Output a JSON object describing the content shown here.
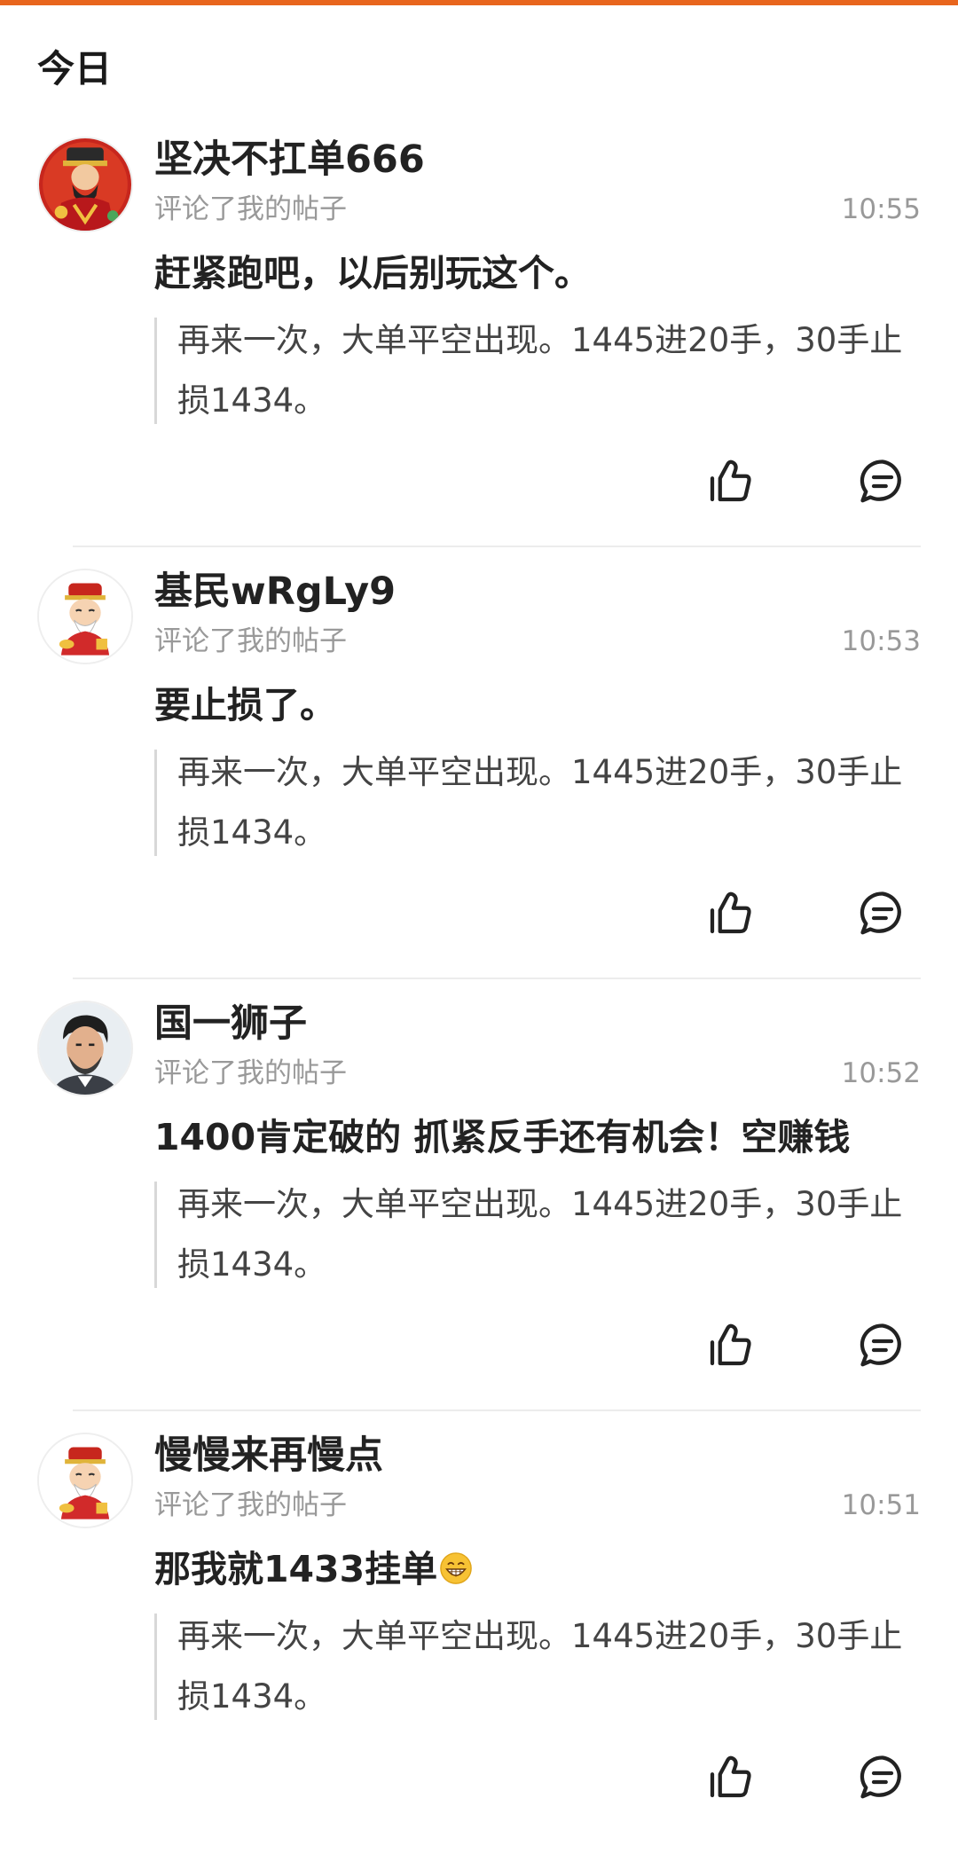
{
  "accent_color": "#e8651d",
  "section": {
    "title": "今日"
  },
  "items": [
    {
      "username": "坚决不扛单666",
      "action": "评论了我的帖子",
      "time": "10:55",
      "comment": "赶紧跑吧，以后别玩这个。",
      "quote": "再来一次，大单平空出现。1445进20手，30手止损1434。",
      "avatar": "fortune-god-avatar"
    },
    {
      "username": "基民wRgLy9",
      "action": "评论了我的帖子",
      "time": "10:53",
      "comment": "要止损了。",
      "quote": "再来一次，大单平空出现。1445进20手，30手止损1434。",
      "avatar": "cartoon-fortune-avatar"
    },
    {
      "username": "国一狮子",
      "action": "评论了我的帖子",
      "time": "10:52",
      "comment": "1400肯定破的 抓紧反手还有机会！空赚钱",
      "quote": "再来一次，大单平空出现。1445进20手，30手止损1434。",
      "avatar": "man-portrait-avatar"
    },
    {
      "username": "慢慢来再慢点",
      "action": "评论了我的帖子",
      "time": "10:51",
      "comment": "那我就1433挂单",
      "comment_emoji": "grinning-face-emoji",
      "quote": "再来一次，大单平空出现。1445进20手，30手止损1434。",
      "avatar": "cartoon-fortune-avatar"
    }
  ],
  "icons": {
    "like": "thumbs-up-icon",
    "reply": "comment-bubble-icon"
  }
}
